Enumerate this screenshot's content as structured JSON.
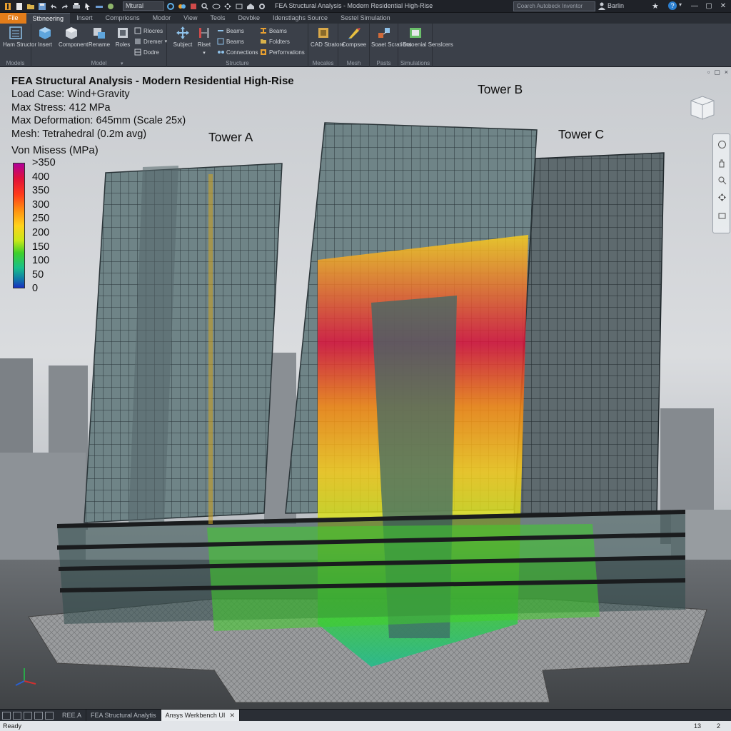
{
  "titlebar": {
    "app_title": "FEA Structural Analysis - Modern Residential High-Rise",
    "workspace": "Mtural",
    "search_placeholder": "Coarch Autobeck Inventor",
    "user": "Barlin"
  },
  "ribbon_tabs": [
    "File",
    "Stbneering",
    "Insert",
    "Compriosns",
    "Modor",
    "View",
    "Teols",
    "Devbke",
    "Idenstlaghs Source",
    "Sestel Simulation"
  ],
  "ribbon_groups": [
    {
      "label": "Models",
      "big": [
        "Ham Structor"
      ]
    },
    {
      "label": "Model",
      "big": [
        "Insert",
        "Component",
        "Rename",
        "Roles"
      ],
      "small": [
        "Rlocres",
        "Dremer",
        "Dodre"
      ]
    },
    {
      "label": "Structure",
      "big": [
        "Subject",
        "Riset"
      ],
      "small": [
        "Beams",
        "Beams",
        "Connections",
        "Beams",
        "Foldters",
        "Perforrvations"
      ]
    },
    {
      "label": "Mecales",
      "big": [
        "CAD Stratore"
      ]
    },
    {
      "label": "Mesh",
      "big": [
        "Compsee"
      ]
    },
    {
      "label": "Pasts",
      "big": [
        "Soaet Scrations"
      ]
    },
    {
      "label": "Simulations",
      "big": [
        "Eotoenial Senslcers"
      ]
    }
  ],
  "analysis": {
    "title": "FEA Structural Analysis - Modern Residential High-Rise",
    "load_case": "Load Case: Wind+Gravity",
    "max_stress": "Max Stress: 412 MPa",
    "max_deformation": "Max Deformation: 645mm (Scale 25x)",
    "mesh": "Mesh: Tetrahedral (0.2m avg)"
  },
  "legend": {
    "title": "Von Misess (MPa)",
    "labels": [
      ">350",
      "400",
      "350",
      "300",
      "250",
      "200",
      "150",
      "100",
      "50",
      "0"
    ],
    "colors": [
      "#b0009a",
      "#e0103a",
      "#ff3b1a",
      "#ff8c10",
      "#ffd21a",
      "#c8e818",
      "#3fd02a",
      "#18c08a",
      "#0f7aa8",
      "#1830c0"
    ]
  },
  "towers": [
    "Tower A",
    "Tower B",
    "Tower C"
  ],
  "viewport_controls": [
    "▫",
    "▢",
    "×"
  ],
  "doc_tabs": [
    "REE.A",
    "FEA Structural Analytis",
    "Ansys Werkbench UI"
  ],
  "status": {
    "text": "Ready",
    "count_a": "13",
    "count_b": "2"
  },
  "colors": {
    "accent": "#e37d1a",
    "ribbon_bg": "#3b4049",
    "titlebar_bg": "#1f2228"
  }
}
